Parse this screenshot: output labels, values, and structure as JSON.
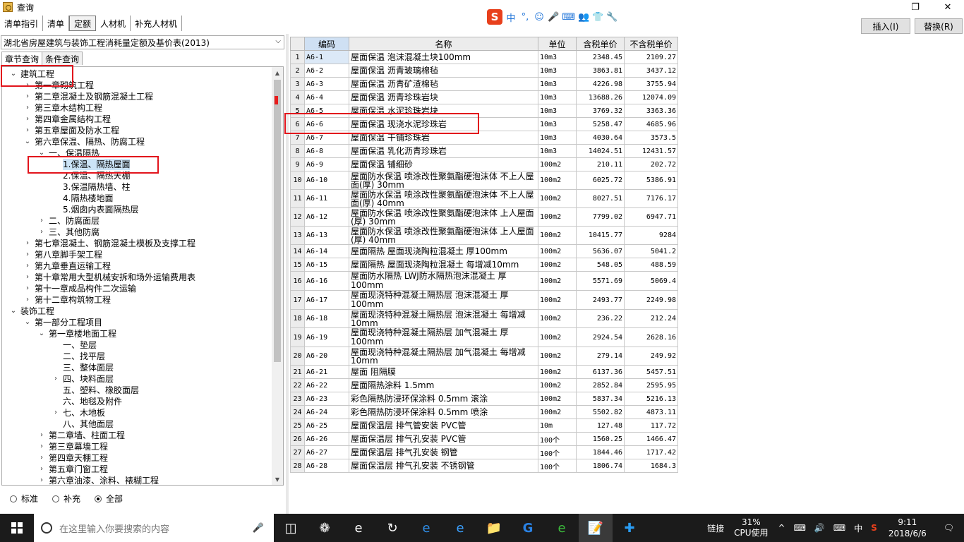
{
  "window": {
    "title": "查询",
    "restore_glyph": "❐",
    "close_glyph": "✕"
  },
  "ime": {
    "logo": "S",
    "items": [
      "中",
      "°,",
      "☺",
      "🎤",
      "⌨",
      "👥",
      "👕",
      "🔧"
    ]
  },
  "tabs": [
    "清单指引",
    "清单",
    "定额",
    "人材机",
    "补充人材机"
  ],
  "active_tab_index": 2,
  "buttons": {
    "insert": "插入(I)",
    "replace": "替换(R)"
  },
  "book": {
    "selected": "湖北省房屋建筑与装饰工程消耗量定额及基价表(2013)"
  },
  "subtabs": [
    "章节查询",
    "条件查询"
  ],
  "tree": [
    {
      "label": "建筑工程",
      "level": 0,
      "twist": "v"
    },
    {
      "label": "第一章砌筑工程",
      "level": 1,
      "twist": ">"
    },
    {
      "label": "第二章混凝土及钢筋混凝土工程",
      "level": 1,
      "twist": ">"
    },
    {
      "label": "第三章木结构工程",
      "level": 1,
      "twist": ">"
    },
    {
      "label": "第四章金属结构工程",
      "level": 1,
      "twist": ">"
    },
    {
      "label": "第五章屋面及防水工程",
      "level": 1,
      "twist": ">"
    },
    {
      "label": "第六章保温、隔热、防腐工程",
      "level": 1,
      "twist": "v"
    },
    {
      "label": "一、保温隔热",
      "level": 2,
      "twist": "v"
    },
    {
      "label": "1.保温、隔热屋面",
      "level": 3,
      "twist": "",
      "selected": true
    },
    {
      "label": "2.保温、隔热天棚",
      "level": 3,
      "twist": ""
    },
    {
      "label": "3.保温隔热墙、柱",
      "level": 3,
      "twist": ""
    },
    {
      "label": "4.隔热楼地面",
      "level": 3,
      "twist": ""
    },
    {
      "label": "5.烟囱内表面隔热层",
      "level": 3,
      "twist": ""
    },
    {
      "label": "二、防腐面层",
      "level": 2,
      "twist": ">"
    },
    {
      "label": "三、其他防腐",
      "level": 2,
      "twist": ">"
    },
    {
      "label": "第七章混凝土、钢筋混凝土模板及支撑工程",
      "level": 1,
      "twist": ">"
    },
    {
      "label": "第八章脚手架工程",
      "level": 1,
      "twist": ">"
    },
    {
      "label": "第九章垂直运输工程",
      "level": 1,
      "twist": ">"
    },
    {
      "label": "第十章常用大型机械安拆和场外运输费用表",
      "level": 1,
      "twist": ">"
    },
    {
      "label": "第十一章成品构件二次运输",
      "level": 1,
      "twist": ">"
    },
    {
      "label": "第十二章构筑物工程",
      "level": 1,
      "twist": ">"
    },
    {
      "label": "装饰工程",
      "level": 0,
      "twist": "v"
    },
    {
      "label": "第一部分工程项目",
      "level": 1,
      "twist": "v"
    },
    {
      "label": "第一章楼地面工程",
      "level": 2,
      "twist": "v"
    },
    {
      "label": "一、垫层",
      "level": 3,
      "twist": ""
    },
    {
      "label": "二、找平层",
      "level": 3,
      "twist": ""
    },
    {
      "label": "三、整体面层",
      "level": 3,
      "twist": ""
    },
    {
      "label": "四、块料面层",
      "level": 3,
      "twist": ">"
    },
    {
      "label": "五、塑料、橡胶面层",
      "level": 3,
      "twist": ""
    },
    {
      "label": "六、地毯及附件",
      "level": 3,
      "twist": ""
    },
    {
      "label": "七、木地板",
      "level": 3,
      "twist": ">"
    },
    {
      "label": "八、其他面层",
      "level": 3,
      "twist": ""
    },
    {
      "label": "第二章墙、柱面工程",
      "level": 2,
      "twist": ">"
    },
    {
      "label": "第三章幕墙工程",
      "level": 2,
      "twist": ">"
    },
    {
      "label": "第四章天棚工程",
      "level": 2,
      "twist": ">"
    },
    {
      "label": "第五章门窗工程",
      "level": 2,
      "twist": ">"
    },
    {
      "label": "第六章油漆、涂料、裱糊工程",
      "level": 2,
      "twist": ">"
    }
  ],
  "filter": {
    "options": [
      "标准",
      "补充",
      "全部"
    ],
    "selected_index": 2
  },
  "grid": {
    "columns": [
      "编码",
      "名称",
      "单位",
      "含税单价",
      "不含税单价"
    ],
    "rows": [
      [
        "1",
        "A6-1",
        "屋面保温 泡沫混凝土块100mm",
        "10m3",
        "2348.45",
        "2109.27"
      ],
      [
        "2",
        "A6-2",
        "屋面保温 沥青玻璃棉毡",
        "10m3",
        "3863.81",
        "3437.12"
      ],
      [
        "3",
        "A6-3",
        "屋面保温 沥青矿渣棉毡",
        "10m3",
        "4226.98",
        "3755.94"
      ],
      [
        "4",
        "A6-4",
        "屋面保温 沥青珍珠岩块",
        "10m3",
        "13688.26",
        "12074.09"
      ],
      [
        "5",
        "A6-5",
        "屋面保温 水泥珍珠岩块",
        "10m3",
        "3769.32",
        "3363.36"
      ],
      [
        "6",
        "A6-6",
        "屋面保温 现浇水泥珍珠岩",
        "10m3",
        "5258.47",
        "4685.96"
      ],
      [
        "7",
        "A6-7",
        "屋面保温 干铺珍珠岩",
        "10m3",
        "4030.64",
        "3573.5"
      ],
      [
        "8",
        "A6-8",
        "屋面保温 乳化沥青珍珠岩",
        "10m3",
        "14024.51",
        "12431.57"
      ],
      [
        "9",
        "A6-9",
        "屋面保温 铺细砂",
        "100m2",
        "210.11",
        "202.72"
      ],
      [
        "10",
        "A6-10",
        "屋面防水保温 喷涂改性聚氨酯硬泡沫体 不上人屋面(厚) 30mm",
        "100m2",
        "6025.72",
        "5386.91"
      ],
      [
        "11",
        "A6-11",
        "屋面防水保温 喷涂改性聚氨酯硬泡沫体 不上人屋面(厚) 40mm",
        "100m2",
        "8027.51",
        "7176.17"
      ],
      [
        "12",
        "A6-12",
        "屋面防水保温 喷涂改性聚氨酯硬泡沫体 上人屋面(厚) 30mm",
        "100m2",
        "7799.02",
        "6947.71"
      ],
      [
        "13",
        "A6-13",
        "屋面防水保温 喷涂改性聚氨酯硬泡沫体 上人屋面(厚) 40mm",
        "100m2",
        "10415.77",
        "9284"
      ],
      [
        "14",
        "A6-14",
        "屋面隔热 屋面现浇陶粒混凝土 厚100mm",
        "100m2",
        "5636.07",
        "5041.2"
      ],
      [
        "15",
        "A6-15",
        "屋面隔热 屋面现浇陶粒混凝土 每增减10mm",
        "100m2",
        "548.05",
        "488.59"
      ],
      [
        "16",
        "A6-16",
        "屋面防水隔热 LWJ防水隔热泡沫混凝土 厚100mm",
        "100m2",
        "5571.69",
        "5069.4"
      ],
      [
        "17",
        "A6-17",
        "屋面现浇特种混凝土隔热层 泡沫混凝土 厚100mm",
        "100m2",
        "2493.77",
        "2249.98"
      ],
      [
        "18",
        "A6-18",
        "屋面现浇特种混凝土隔热层 泡沫混凝土 每增减10mm",
        "100m2",
        "236.22",
        "212.24"
      ],
      [
        "19",
        "A6-19",
        "屋面现浇特种混凝土隔热层 加气混凝土 厚100mm",
        "100m2",
        "2924.54",
        "2628.16"
      ],
      [
        "20",
        "A6-20",
        "屋面现浇特种混凝土隔热层 加气混凝土 每增减10mm",
        "100m2",
        "279.14",
        "249.92"
      ],
      [
        "21",
        "A6-21",
        "屋面 阻隔膜",
        "100m2",
        "6137.36",
        "5457.51"
      ],
      [
        "22",
        "A6-22",
        "屋面隔热涂料 1.5mm",
        "100m2",
        "2852.84",
        "2595.95"
      ],
      [
        "23",
        "A6-23",
        "彩色隔热防浸环保涂料 0.5mm 滚涂",
        "100m2",
        "5837.34",
        "5216.13"
      ],
      [
        "24",
        "A6-24",
        "彩色隔热防浸环保涂料 0.5mm 喷涂",
        "100m2",
        "5502.82",
        "4873.11"
      ],
      [
        "25",
        "A6-25",
        "屋面保温层 排气管安装 PVC管",
        "10m",
        "127.48",
        "117.72"
      ],
      [
        "26",
        "A6-26",
        "屋面保温层 排气孔安装 PVC管",
        "100个",
        "1560.25",
        "1466.47"
      ],
      [
        "27",
        "A6-27",
        "屋面保温层 排气孔安装 钢管",
        "100个",
        "1844.46",
        "1717.42"
      ],
      [
        "28",
        "A6-28",
        "屋面保温层 排气孔安装 不锈钢管",
        "100个",
        "1806.74",
        "1684.3"
      ]
    ]
  },
  "taskbar": {
    "search_placeholder": "在这里输入你要搜索的内容",
    "icons": [
      "task-view",
      "fan",
      "ie-e",
      "swirl",
      "edge",
      "ie",
      "folder",
      "sogou-g",
      "green-ie",
      "notepad",
      "plus-app"
    ],
    "link_label": "链接",
    "cpu_percent": "31%",
    "cpu_label": "CPU使用",
    "tray_glyphs": [
      "^",
      "⌨",
      "🔊",
      "⌨",
      "中",
      "S"
    ],
    "time": "9:11",
    "date": "2018/6/6"
  }
}
